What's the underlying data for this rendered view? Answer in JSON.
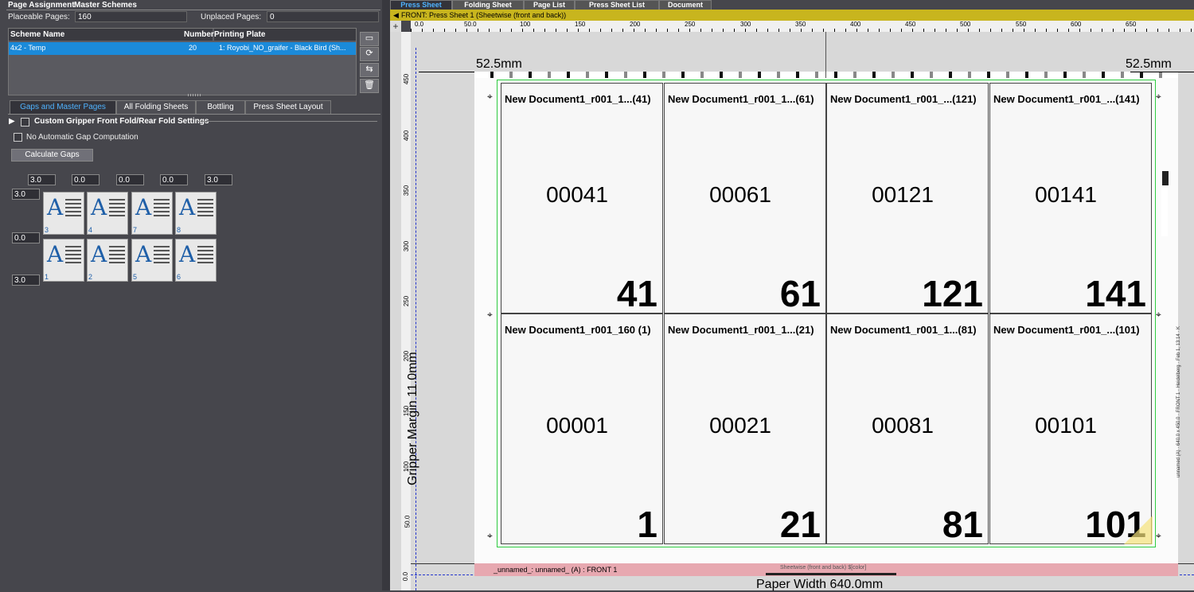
{
  "left": {
    "title_page_assignment": "Page Assignment",
    "title_master_schemes": "Master Schemes",
    "placeable_label": "Placeable Pages:",
    "placeable_value": "160",
    "unplaced_label": "Unplaced Pages:",
    "unplaced_value": "0",
    "table": {
      "col_scheme": "Scheme Name",
      "col_number": "Number",
      "col_plate": "Printing Plate",
      "row": {
        "scheme": "4x2 - Temp",
        "number": "20",
        "plate": "1: Royobi_NO_graifer - Black Bird (Sh..."
      }
    },
    "tabs": [
      "Gaps and Master Pages",
      "All Folding Sheets",
      "Bottling",
      "Press Sheet Layout"
    ],
    "custom_gripper": "Custom Gripper Front Fold/Rear Fold Settings",
    "no_auto_gap": "No Automatic Gap Computation",
    "calc_gaps": "Calculate Gaps",
    "top_gaps": [
      "3.0",
      "0.0",
      "0.0",
      "0.0",
      "3.0"
    ],
    "side_gaps": [
      "3.0",
      "0.0",
      "3.0"
    ],
    "thumbs_row1": [
      "3",
      "4",
      "7",
      "8"
    ],
    "thumbs_row2": [
      "1",
      "2",
      "5",
      "6"
    ]
  },
  "right": {
    "tabs": [
      "Press Sheet",
      "Folding Sheet",
      "Page List",
      "Press Sheet List",
      "Document"
    ],
    "sheet_title": "FRONT:  Press Sheet 1 (Sheetwise (front and back))",
    "ruler_top": [
      "0.0",
      "50.0",
      "100",
      "150",
      "200",
      "250",
      "300",
      "350",
      "400",
      "450",
      "500",
      "550",
      "600",
      "650"
    ],
    "ruler_left": [
      "450",
      "400",
      "350",
      "300",
      "250",
      "200",
      "150",
      "100",
      "50.0",
      "0.0"
    ],
    "margin_left": "52.5mm",
    "margin_right": "52.5mm",
    "gripper": "Gripper Margin 11.0mm",
    "paper_width": "Paper Width 640.0mm",
    "bottom_strip": "_unnamed_: unnamed_ (A) : FRONT 1",
    "bottom_strip2": "Sheetwise (front and back) $[color]",
    "side_mark": "unnamed (A) · 640.0 x 450.0 · FRONT 1 · Heidelberg · Feb 1, 13:14 · K",
    "cells_top": [
      {
        "title": "New Document1_r001_1...(41)",
        "code": "00041",
        "page": "41"
      },
      {
        "title": "New Document1_r001_1...(61)",
        "code": "00061",
        "page": "61"
      },
      {
        "title": "New Document1_r001_...(121)",
        "code": "00121",
        "page": "121"
      },
      {
        "title": "New Document1_r001_...(141)",
        "code": "00141",
        "page": "141"
      }
    ],
    "cells_bottom": [
      {
        "title": "New Document1_r001_160 (1)",
        "code": "00001",
        "page": "1"
      },
      {
        "title": "New Document1_r001_1...(21)",
        "code": "00021",
        "page": "21"
      },
      {
        "title": "New Document1_r001_1...(81)",
        "code": "00081",
        "page": "81"
      },
      {
        "title": "New Document1_r001_...(101)",
        "code": "00101",
        "page": "101"
      }
    ]
  }
}
